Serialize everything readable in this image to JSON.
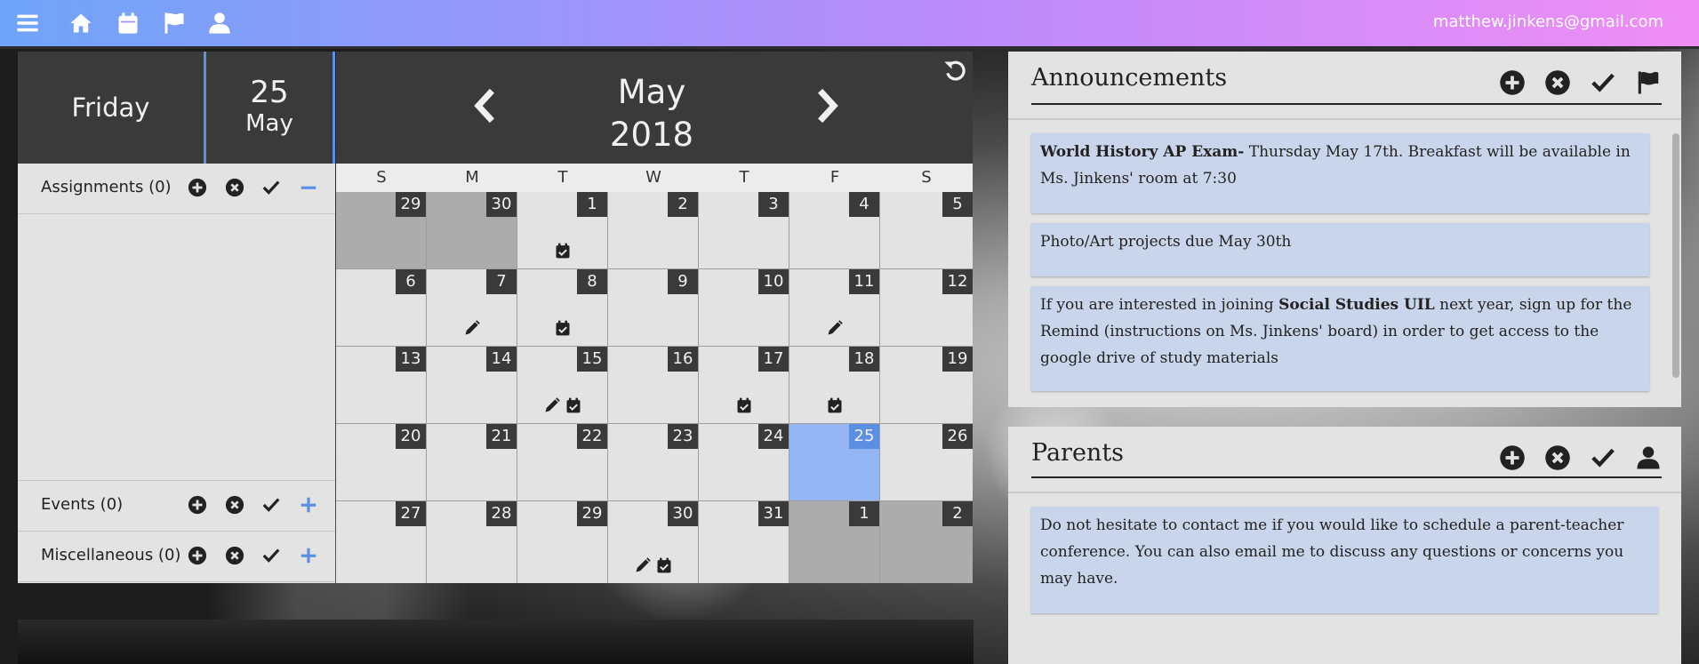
{
  "user": {
    "email": "matthew.jinkens@gmail.com"
  },
  "nav": [
    "menu-icon",
    "home-icon",
    "calendar-icon",
    "flag-icon",
    "user-icon"
  ],
  "selected_day": {
    "weekday": "Friday",
    "day": "25",
    "month": "May"
  },
  "categories": [
    {
      "label": "Assignments (0)",
      "toggle": "minus"
    },
    {
      "label": "Events (0)",
      "toggle": "plus"
    },
    {
      "label": "Miscellaneous (0)",
      "toggle": "plus"
    }
  ],
  "calendar": {
    "month": "May",
    "year": "2018",
    "weekdays": [
      "S",
      "M",
      "T",
      "W",
      "T",
      "F",
      "S"
    ],
    "weeks": [
      [
        {
          "d": "29",
          "other": true
        },
        {
          "d": "30",
          "other": true
        },
        {
          "d": "1",
          "marks": [
            "event"
          ]
        },
        {
          "d": "2"
        },
        {
          "d": "3"
        },
        {
          "d": "4"
        },
        {
          "d": "5"
        }
      ],
      [
        {
          "d": "6"
        },
        {
          "d": "7",
          "marks": [
            "assignment"
          ]
        },
        {
          "d": "8",
          "marks": [
            "event"
          ]
        },
        {
          "d": "9"
        },
        {
          "d": "10"
        },
        {
          "d": "11",
          "marks": [
            "assignment"
          ]
        },
        {
          "d": "12"
        }
      ],
      [
        {
          "d": "13"
        },
        {
          "d": "14"
        },
        {
          "d": "15",
          "marks": [
            "assignment",
            "event"
          ]
        },
        {
          "d": "16"
        },
        {
          "d": "17",
          "marks": [
            "event"
          ]
        },
        {
          "d": "18",
          "marks": [
            "event"
          ]
        },
        {
          "d": "19"
        }
      ],
      [
        {
          "d": "20"
        },
        {
          "d": "21"
        },
        {
          "d": "22"
        },
        {
          "d": "23"
        },
        {
          "d": "24"
        },
        {
          "d": "25",
          "today": true
        },
        {
          "d": "26"
        }
      ],
      [
        {
          "d": "27"
        },
        {
          "d": "28"
        },
        {
          "d": "29"
        },
        {
          "d": "30",
          "marks": [
            "assignment",
            "event"
          ]
        },
        {
          "d": "31"
        },
        {
          "d": "1",
          "other": true
        },
        {
          "d": "2",
          "other": true
        }
      ]
    ]
  },
  "announcements": {
    "title": "Announcements",
    "items": [
      {
        "bold": "World History AP Exam-",
        "text": " Thursday May 17th. Breakfast will be available in Ms. Jinkens' room at 7:30"
      },
      {
        "text": "Photo/Art projects due May 30th"
      },
      {
        "pre": "If you are interested in joining ",
        "bold": "Social Studies UIL",
        "text": " next year, sign up for the Remind (instructions on Ms. Jinkens' board) in order to get access to the google drive of study materials"
      }
    ]
  },
  "parents": {
    "title": "Parents",
    "items": [
      {
        "text": "Do not hesitate to contact me if you would like to schedule a parent-teacher conference. You can also email me to discuss any questions or concerns you may have."
      }
    ]
  }
}
